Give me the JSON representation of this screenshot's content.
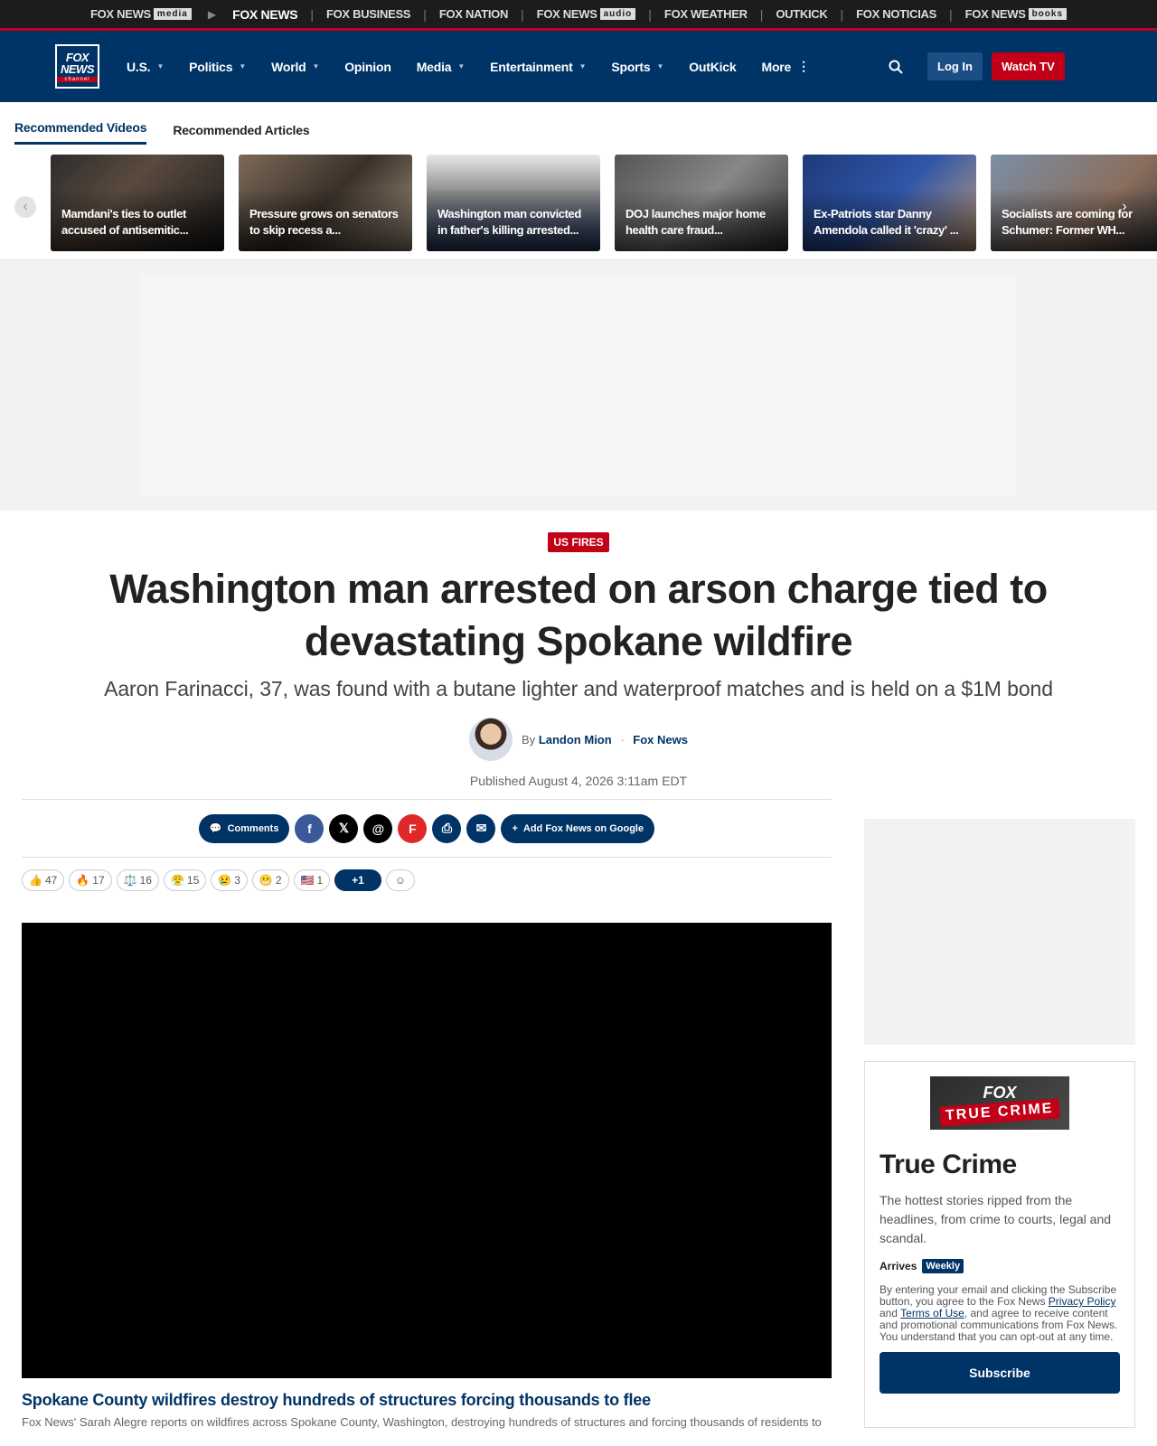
{
  "network": {
    "items": [
      {
        "name": "FOX NEWS",
        "tag": "media"
      },
      {
        "name": "FOX NEWS",
        "tag": ""
      },
      {
        "name": "FOX BUSINESS",
        "tag": ""
      },
      {
        "name": "FOX NATION",
        "tag": ""
      },
      {
        "name": "FOX NEWS",
        "tag": "audio"
      },
      {
        "name": "FOX WEATHER",
        "tag": ""
      },
      {
        "name": "OUTKICK",
        "tag": ""
      },
      {
        "name": "FOX NOTICIAS",
        "tag": ""
      },
      {
        "name": "FOX NEWS",
        "tag": "books"
      }
    ]
  },
  "nav": {
    "logo_line1": "FOX",
    "logo_line2": "NEWS",
    "logo_line3": "channel",
    "items": [
      "U.S.",
      "Politics",
      "World",
      "Opinion",
      "Media",
      "Entertainment",
      "Sports",
      "OutKick",
      "More"
    ],
    "login": "Log In",
    "watch": "Watch TV"
  },
  "rec_tabs": [
    "Recommended Videos",
    "Recommended Articles"
  ],
  "carousel": [
    "Mamdani's ties to outlet accused of antisemitic...",
    "Pressure grows on senators to skip recess a...",
    "Washington man convicted in father's killing arrested...",
    "DOJ launches major home health care fraud...",
    "Ex-Patriots star Danny Amendola called it 'crazy' ...",
    "Socialists are coming for Schumer: Former WH..."
  ],
  "article": {
    "kicker": "US FIRES",
    "headline": "Washington man arrested on arson charge tied to devastating Spokane wildfire",
    "subhead": "Aaron Farinacci, 37, was found with a butane lighter and waterproof matches and is held on a $1M bond",
    "by": "By",
    "author": "Landon Mion",
    "org": "Fox News",
    "published": "Published August 4, 2026 3:11am EDT"
  },
  "share": {
    "comments": "Comments",
    "add_google": "Add Fox News on Google"
  },
  "reactions": [
    {
      "icon": "👍",
      "count": "47"
    },
    {
      "icon": "🔥",
      "count": "17"
    },
    {
      "icon": "⚖️",
      "count": "16"
    },
    {
      "icon": "😤",
      "count": "15"
    },
    {
      "icon": "😢",
      "count": "3"
    },
    {
      "icon": "😬",
      "count": "2"
    },
    {
      "icon": "🇺🇸",
      "count": "1"
    }
  ],
  "reactions_more": "+1",
  "video": {
    "title": "Spokane County wildfires destroy hundreds of structures forcing thousands to flee",
    "desc": "Fox News' Sarah Alegre reports on wildfires across Spokane County, Washington, destroying hundreds of structures and forcing thousands of residents to"
  },
  "newsletter": {
    "logo_fox": "FOX",
    "logo_tag": "TRUE CRIME",
    "title": "True Crime",
    "desc": "The hottest stories ripped from the headlines, from crime to courts, legal and scandal.",
    "arrives": "Arrives",
    "freq": "Weekly",
    "terms1": "By entering your email and clicking the Subscribe button, you agree to the Fox News ",
    "privacy": "Privacy Policy",
    "and": " and ",
    "terms_link": "Terms of Use",
    "terms2": ", and agree to receive content and promotional communications from Fox News. You understand that you can opt-out at any time.",
    "subscribe": "Subscribe"
  }
}
